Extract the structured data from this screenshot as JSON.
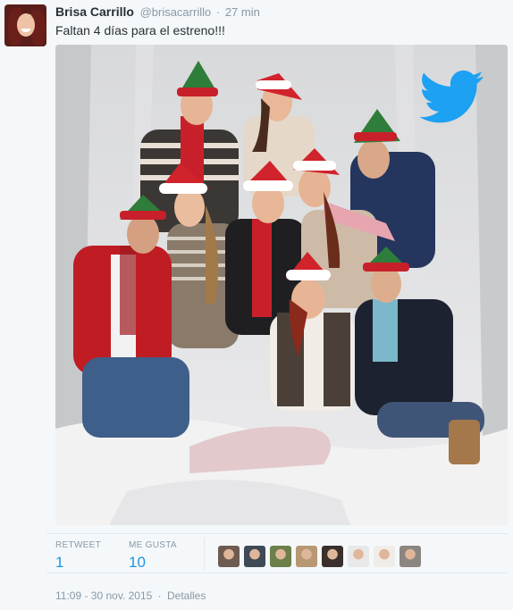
{
  "tweet": {
    "author_name": "Brisa Carrillo",
    "author_handle": "@brisacarrillo",
    "separator": "·",
    "relative_time": "27 min",
    "text": "Faltan 4 días para el estreno!!!"
  },
  "stats": {
    "retweet_label": "RETWEET",
    "retweet_count": "1",
    "like_label": "ME GUSTA",
    "like_count": "10"
  },
  "likers": [
    {
      "color": "#6d5a50"
    },
    {
      "color": "#3e4a55"
    },
    {
      "color": "#6a7f4a"
    },
    {
      "color": "#b89872"
    },
    {
      "color": "#3a2f2c"
    },
    {
      "color": "#e8e8e8"
    },
    {
      "color": "#f0ece8"
    },
    {
      "color": "#8b8680"
    }
  ],
  "footer": {
    "timestamp": "11:09 - 30 nov. 2015",
    "separator": "·",
    "details_label": "Detalles"
  },
  "colors": {
    "accent": "#1b95e0",
    "twitter_blue": "#1da1f2",
    "muted": "#8899a6"
  }
}
